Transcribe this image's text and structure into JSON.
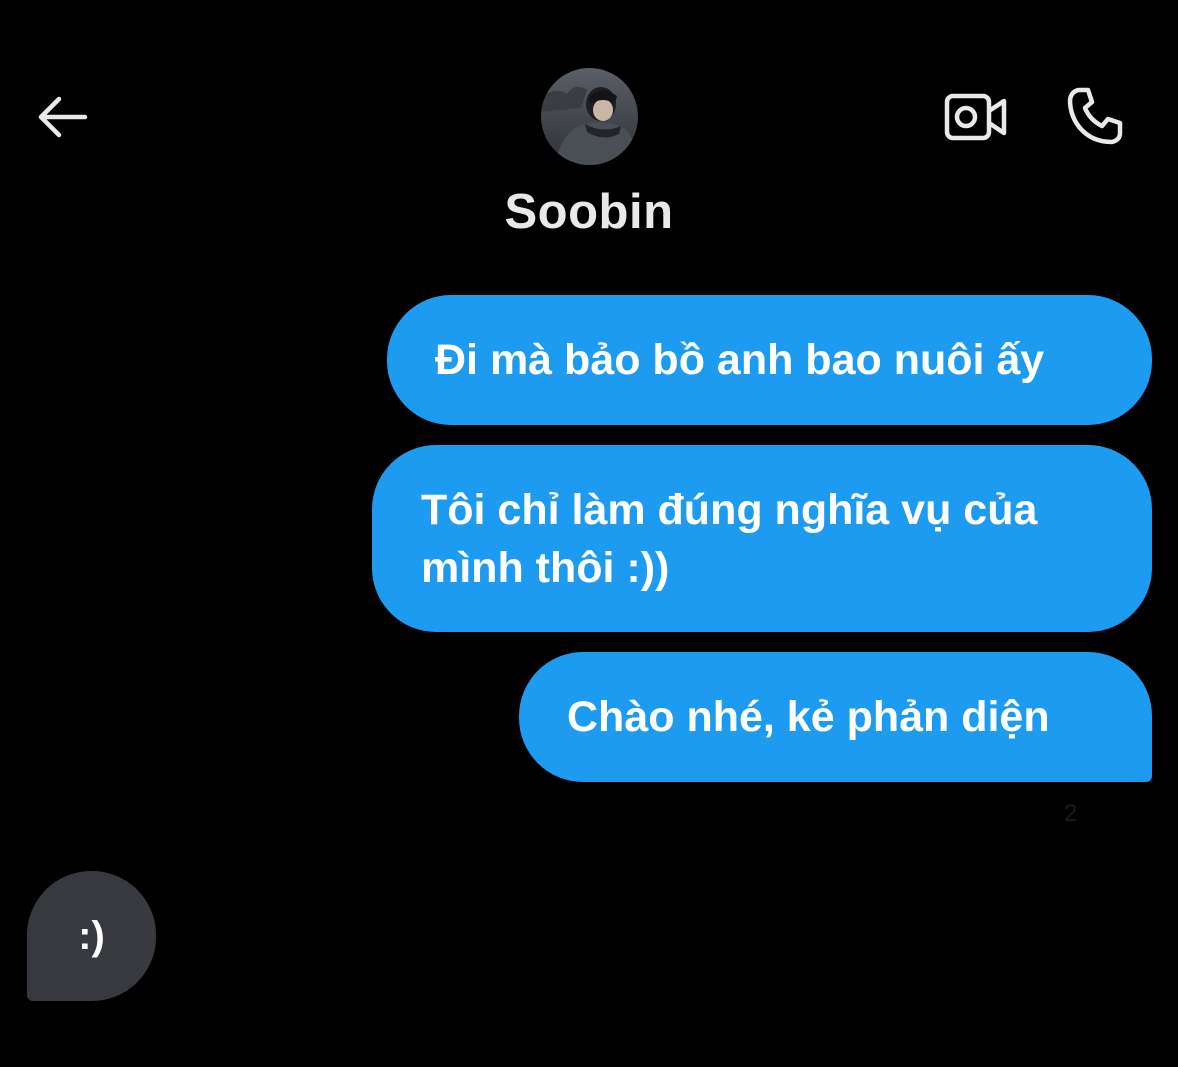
{
  "header": {
    "back_icon": "arrow-left-icon",
    "contact_name": "Soobin",
    "video_icon": "video-camera-icon",
    "call_icon": "phone-icon"
  },
  "messages": [
    {
      "direction": "outgoing",
      "text": "Đi mà bảo bồ anh bao nuôi ấy"
    },
    {
      "direction": "outgoing",
      "text": "Tôi chỉ làm đúng nghĩa vụ của mình thôi :))"
    },
    {
      "direction": "outgoing",
      "text": "Chào nhé, kẻ phản diện"
    },
    {
      "direction": "incoming",
      "text": ":)"
    }
  ],
  "timestamp": "2",
  "colors": {
    "background": "#000000",
    "outgoing_bubble": "#1d9bf0",
    "incoming_bubble": "#37393e",
    "text": "#e7e9ea"
  }
}
